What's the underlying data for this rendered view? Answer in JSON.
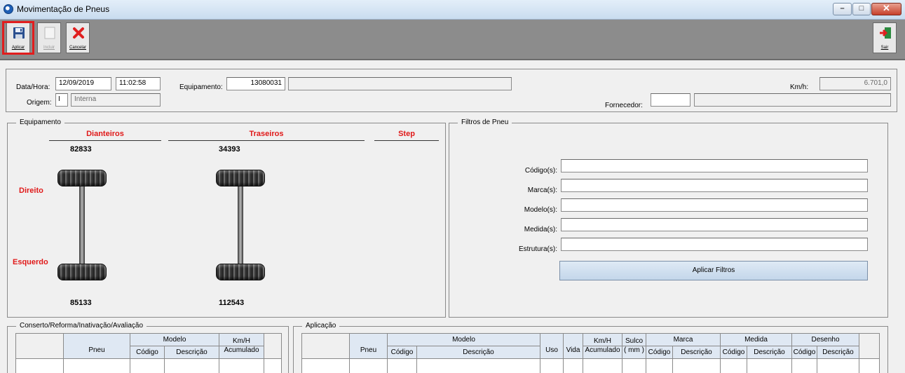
{
  "window": {
    "title": "Movimentação de Pneus",
    "min_glyph": "–",
    "max_glyph": "□",
    "close_glyph": "✕"
  },
  "toolbar": {
    "aplicar": "Aplicar",
    "incluir": "Incluir",
    "cancelar": "Cancelar",
    "sair": "Sair"
  },
  "header": {
    "data_hora_label": "Data/Hora:",
    "date": "12/09/2019",
    "time": "11:02:58",
    "equipamento_label": "Equipamento:",
    "equipamento_code": "13080031",
    "equipamento_desc": "",
    "kmh_label": "Km/h:",
    "kmh_value": "6.701,0",
    "origem_label": "Origem:",
    "origem_code": "I",
    "origem_desc": "Interna",
    "fornecedor_label": "Fornecedor:",
    "fornecedor_code": "",
    "fornecedor_desc": ""
  },
  "equipamento": {
    "title": "Equipamento",
    "dianteiros": "Dianteiros",
    "traseiros": "Traseiros",
    "step": "Step",
    "front_top": "82833",
    "rear_top": "34393",
    "front_bottom": "85133",
    "rear_bottom": "112543",
    "direito": "Direito",
    "esquerdo": "Esquerdo"
  },
  "filtros": {
    "title": "Filtros de Pneu",
    "codigos": "Código(s):",
    "marcas": "Marca(s):",
    "modelos": "Modelo(s):",
    "medidas": "Medida(s):",
    "estruturas": "Estrutura(s):",
    "aplicar_btn": "Aplicar Filtros"
  },
  "conserto": {
    "title": "Conserto/Reforma/Inativação/Avaliação",
    "col_pneu": "Pneu",
    "col_modelo": "Modelo",
    "col_codigo": "Código",
    "col_descricao": "Descrição",
    "col_kmh": "Km/H",
    "col_acumulado": "Acumulado"
  },
  "aplicacao": {
    "title": "Aplicação",
    "col_pneu": "Pneu",
    "col_modelo": "Modelo",
    "col_codigo": "Código",
    "col_descricao": "Descrição",
    "col_uso": "Uso",
    "col_vida": "Vida",
    "col_kmh": "Km/H",
    "col_acumulado": "Acumulado",
    "col_sulco": "Sulco",
    "col_mm": "( mm )",
    "col_marca": "Marca",
    "col_medida": "Medida",
    "col_desenho": "Desenho"
  },
  "colors": {
    "accent_red": "#e01919",
    "toolbar_bg": "#8c8c8c",
    "grid_header": "#dfe8f3"
  }
}
